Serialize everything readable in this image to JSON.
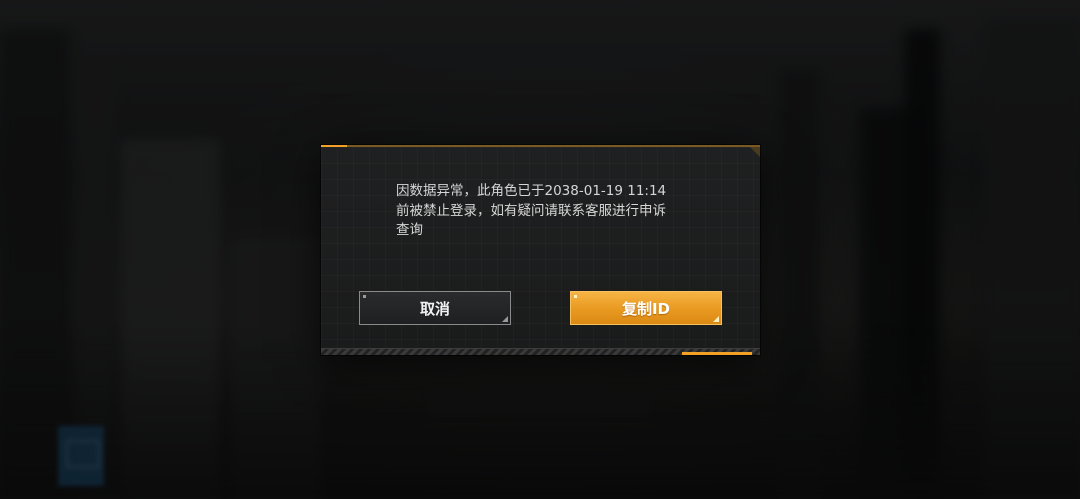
{
  "dialog": {
    "message": "因数据异常，此角色已于2038-01-19 11:14\n前被禁止登录，如有疑问请联系客服进行申诉\n查询",
    "cancel_label": "取消",
    "copy_id_label": "复制ID"
  },
  "colors": {
    "accent": "#f0a126",
    "dialog_bg": "#1c1d1e",
    "primary_button": "#e89920"
  }
}
